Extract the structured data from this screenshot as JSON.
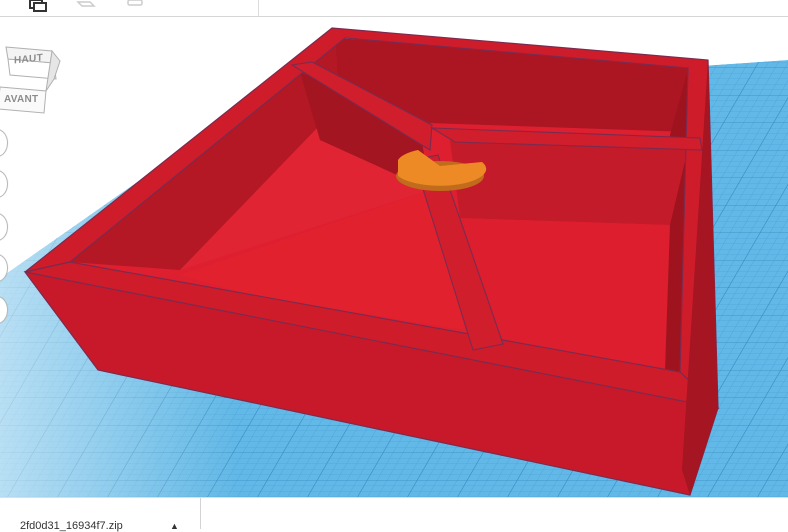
{
  "app": {
    "toolbar": {
      "icons": [
        "copy-icon",
        "workplane-icon",
        "group-icon"
      ]
    },
    "view_cube": {
      "top_label": "HAUT",
      "front_label": "AVANT"
    },
    "view_controls": [
      "home-view-icon",
      "fit-view-icon",
      "zoom-in-icon",
      "zoom-out-icon",
      "perspective-icon"
    ],
    "scene": {
      "object_color": "#d81c2c",
      "handle_color": "#e8892a",
      "grid_color": "#4ea8d8"
    },
    "download_bar": {
      "file_name": "2fd0d31_16934f7.zip"
    }
  }
}
